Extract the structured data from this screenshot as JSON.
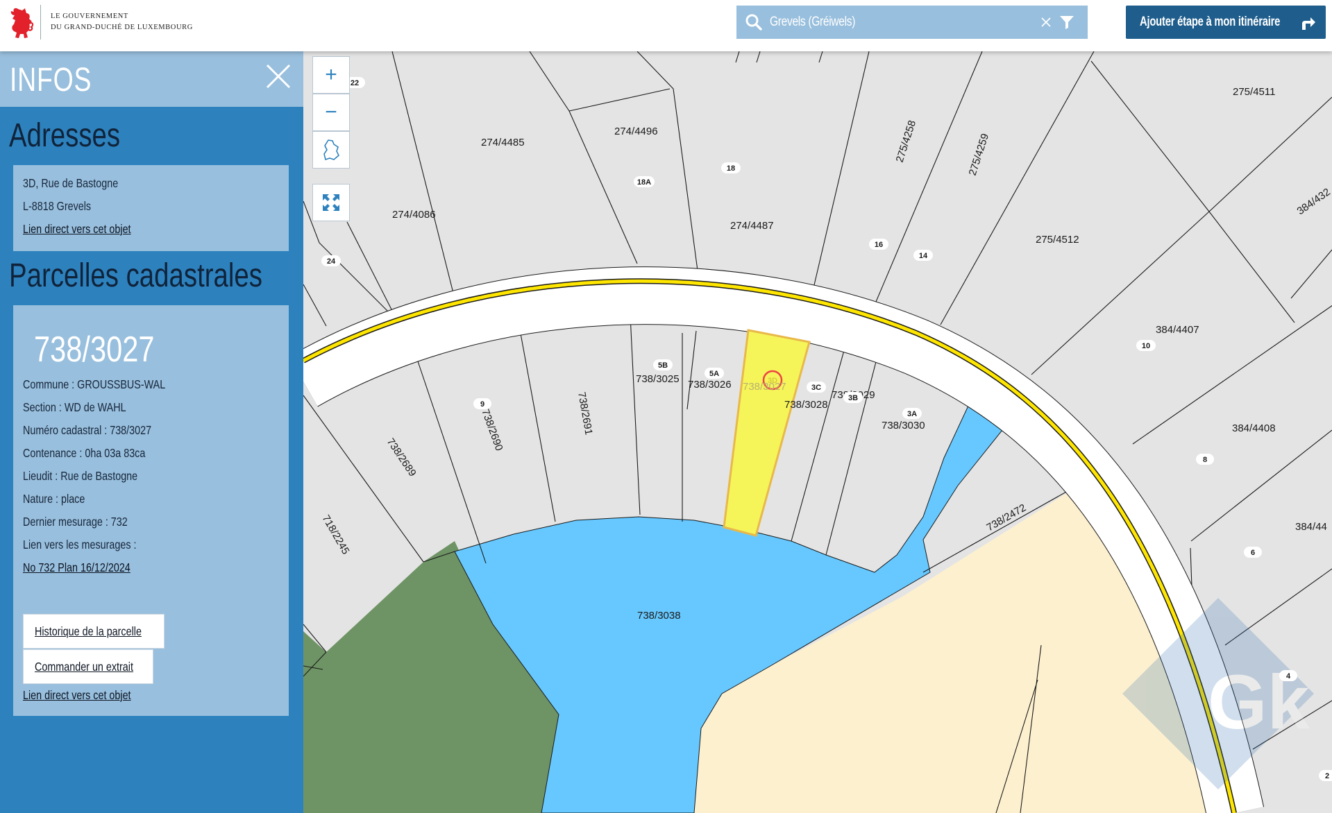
{
  "header": {
    "logo_line1": "Le Gouvernement",
    "logo_line2": "du Grand-Duché de Luxembourg",
    "search_value": "Grevels (Gréiwels)",
    "route_button": "Ajouter étape à mon itinéraire"
  },
  "panel": {
    "title": "INFOS",
    "addresses_title": "Adresses",
    "address_line1": "3D, Rue de Bastogne",
    "address_line2": "L-8818 Grevels",
    "address_link": "Lien direct vers cet objet",
    "parcels_title": "Parcelles cadastrales",
    "parcel_id": "738/3027",
    "commune": "Commune : GROUSSBUS-WAL",
    "section": "Section : WD de WAHL",
    "numero": "Numéro cadastral : 738/3027",
    "contenance": "Contenance : 0ha 03a 83ca",
    "lieudit": "Lieudit : Rue de Bastogne",
    "nature": "Nature : place",
    "dernier": "Dernier mesurage : 732",
    "lien_mesurages": "Lien vers les mesurages :",
    "mesurage_link": "No 732 Plan 16/12/2024",
    "historique_button": "Historique de la parcelle",
    "commander_button": "Commander un extrait",
    "parcel_link": "Lien direct vers cet objet"
  },
  "map": {
    "zoom_in": "+",
    "zoom_out": "−",
    "parcel_labels": [
      {
        "text": "274/4485"
      },
      {
        "text": "274/4496"
      },
      {
        "text": "274/4487"
      },
      {
        "text": "274/4086"
      },
      {
        "text": "275/4258"
      },
      {
        "text": "275/4259"
      },
      {
        "text": "275/4512"
      },
      {
        "text": "275/4511"
      },
      {
        "text": "384/432"
      },
      {
        "text": "384/4407"
      },
      {
        "text": "384/4408"
      },
      {
        "text": "384/44"
      },
      {
        "text": "738/3025"
      },
      {
        "text": "738/3026"
      },
      {
        "text": "738/3027"
      },
      {
        "text": "738/3028"
      },
      {
        "text": "738/3029"
      },
      {
        "text": "738/3030"
      },
      {
        "text": "738/2691"
      },
      {
        "text": "738/2690"
      },
      {
        "text": "738/2689"
      },
      {
        "text": "718/2245"
      },
      {
        "text": "738/2472"
      },
      {
        "text": "738/3038"
      }
    ],
    "house_numbers": [
      {
        "text": "22"
      },
      {
        "text": "18A"
      },
      {
        "text": "18"
      },
      {
        "text": "24"
      },
      {
        "text": "16"
      },
      {
        "text": "14"
      },
      {
        "text": "10"
      },
      {
        "text": "8"
      },
      {
        "text": "6"
      },
      {
        "text": "4"
      },
      {
        "text": "2"
      },
      {
        "text": "5B"
      },
      {
        "text": "5A"
      },
      {
        "text": "3D"
      },
      {
        "text": "3C"
      },
      {
        "text": "3B"
      },
      {
        "text": "3A"
      },
      {
        "text": "9"
      }
    ],
    "colors": {
      "parcel": "#e4e4e4",
      "road": "#ffffff",
      "road_center": "#ffe600",
      "water": "#66c8ff",
      "forest": "#6e9465",
      "field": "#fdf0cf",
      "selected": "#f5f55a",
      "selected_stroke": "#e8b84a",
      "panel": "#2d82be",
      "panel_light": "#98bfdd"
    }
  }
}
